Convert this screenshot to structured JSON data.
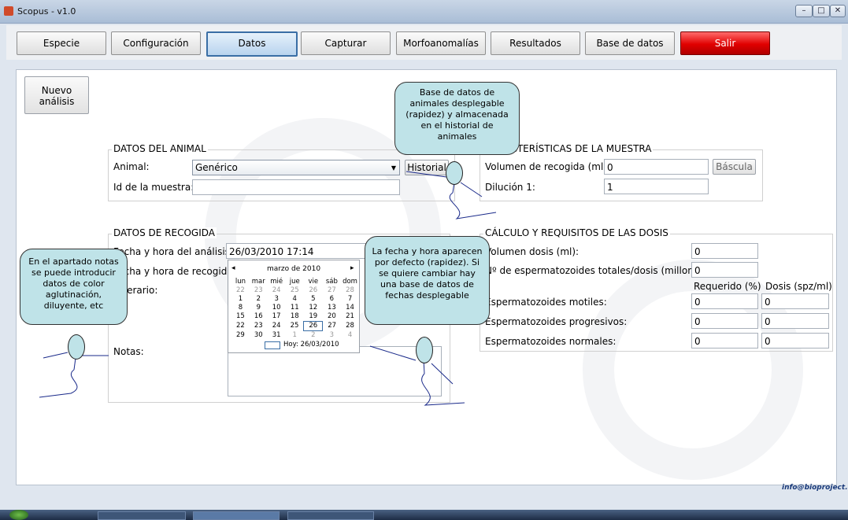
{
  "window": {
    "title": "Scopus - v1.0",
    "minimize": "–",
    "maximize": "□",
    "close": "✕"
  },
  "toolbar": {
    "buttons": [
      {
        "label": "Especie"
      },
      {
        "label": "Configuración"
      },
      {
        "label": "Datos"
      },
      {
        "label": "Capturar"
      },
      {
        "label": "Morfoanomalías"
      },
      {
        "label": "Resultados"
      },
      {
        "label": "Base de datos"
      },
      {
        "label": "Salir"
      }
    ]
  },
  "new_analysis": {
    "line1": "Nuevo",
    "line2": "análisis"
  },
  "animal_group": {
    "title": "DATOS DEL ANIMAL",
    "animal_label": "Animal:",
    "animal_value": "Genérico",
    "history_button": "Historial",
    "sample_id_label": "Id de la muestra:",
    "sample_id_value": ""
  },
  "sample_group": {
    "title": "CARACTERÍSTICAS DE LA MUESTRA",
    "volume_label": "Volumen de recogida (ml):",
    "volume_value": "0",
    "scale_button": "Báscula",
    "dilution_label": "Dilución 1:",
    "dilution_value": "1"
  },
  "collection_group": {
    "title": "DATOS DE RECOGIDA",
    "analysis_datetime_label": "Fecha y hora del análisis:",
    "analysis_datetime_value": "26/03/2010 17:14",
    "collection_datetime_label": "Fecha y hora de recogida:",
    "operator_label": "Operario:",
    "notes_label": "Notas:"
  },
  "calendar": {
    "month": "marzo de 2010",
    "weekdays": [
      "lun",
      "mar",
      "mié",
      "jue",
      "vie",
      "sáb",
      "dom"
    ],
    "weeks": [
      [
        "22",
        "23",
        "24",
        "25",
        "26",
        "27",
        "28"
      ],
      [
        "1",
        "2",
        "3",
        "4",
        "5",
        "6",
        "7"
      ],
      [
        "8",
        "9",
        "10",
        "11",
        "12",
        "13",
        "14"
      ],
      [
        "15",
        "16",
        "17",
        "18",
        "19",
        "20",
        "21"
      ],
      [
        "22",
        "23",
        "24",
        "25",
        "26",
        "27",
        "28"
      ],
      [
        "29",
        "30",
        "31",
        "1",
        "2",
        "3",
        "4"
      ]
    ],
    "today_label": "Hoy: 26/03/2010"
  },
  "dose_group": {
    "title": "CÁLCULO Y REQUISITOS DE LAS DOSIS",
    "dose_volume_label": "Volumen dosis (ml):",
    "dose_volume_value": "0",
    "sperm_per_dose_label": "Nº de espermatozoides totales/dosis (millones):",
    "sperm_per_dose_value": "0",
    "col_required": "Requerido (%)",
    "col_dose": "Dosis (spz/ml)",
    "rows": [
      {
        "label": "Espermatozoides motiles:",
        "required": "0",
        "dose": "0"
      },
      {
        "label": "Espermatozoides progresivos:",
        "required": "0",
        "dose": "0"
      },
      {
        "label": "Espermatozoides normales:",
        "required": "0",
        "dose": "0"
      }
    ]
  },
  "callouts": {
    "database": "Base de datos de animales desplegable (rapidez) y almacenada en el historial de animales",
    "notes": "En el apartado notas se puede introducir datos de color aglutinación, diluyente, etc",
    "date": "La fecha y hora aparecen por defecto (rapidez). Si se quiere cambiar hay una base de datos de fechas desplegable"
  },
  "footer": {
    "email": "info@bioproject.es"
  },
  "colors": {
    "accent": "#3a6ea5",
    "exit": "#e00000",
    "callout": "#bfe3e8"
  }
}
